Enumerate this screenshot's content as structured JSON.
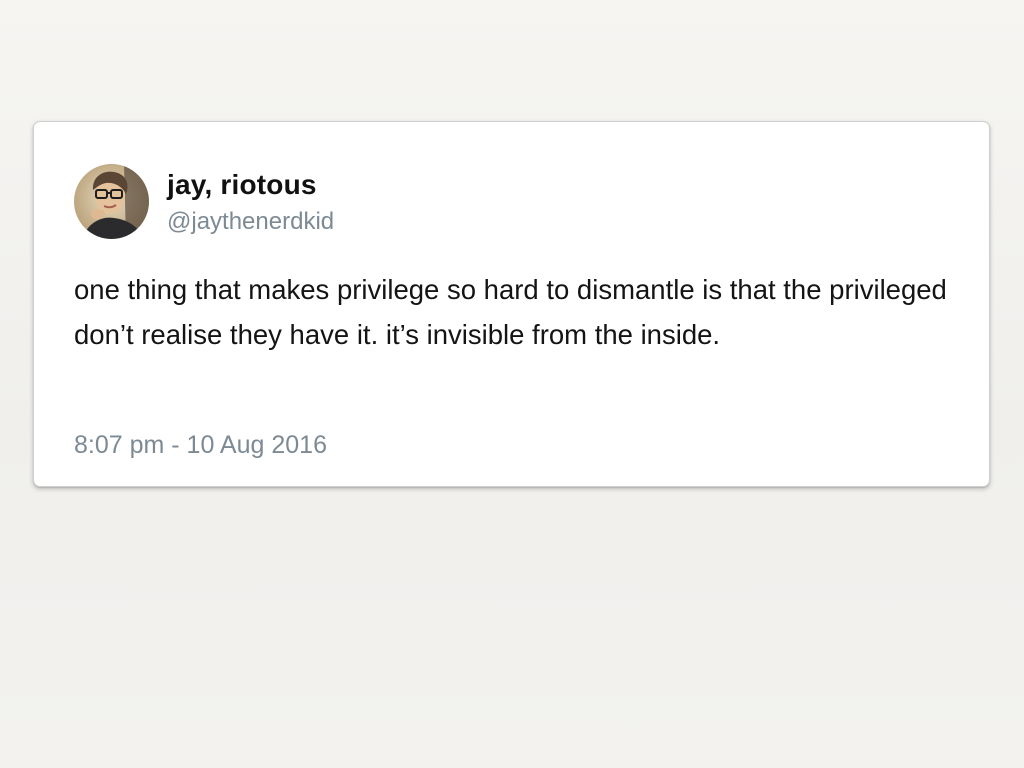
{
  "tweet": {
    "display_name": "jay, riotous",
    "handle": "@jaythenerdkid",
    "text": "one thing that makes privilege so hard to dismantle is that the privileged don’t realise they have it. it’s invisible from the inside.",
    "timestamp": "8:07 pm - 10 Aug 2016",
    "avatar_icon": "profile-photo"
  },
  "colors": {
    "name": "#111111",
    "handle": "#7d8a94",
    "body_text": "#141414",
    "card_background": "#ffffff",
    "page_background": "#f3f2ef"
  }
}
